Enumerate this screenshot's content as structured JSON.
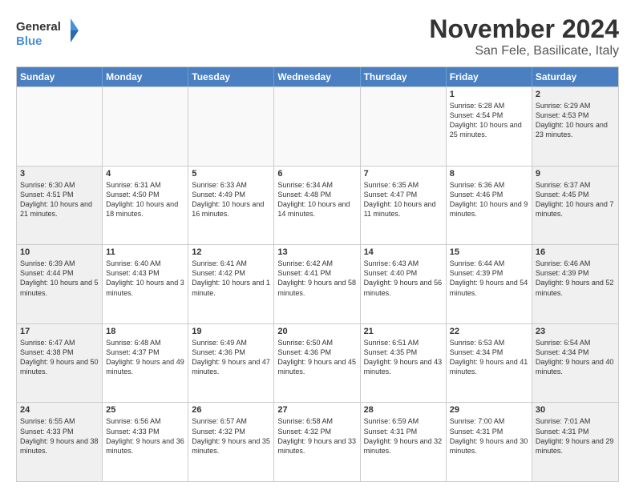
{
  "logo": {
    "line1": "General",
    "line2": "Blue"
  },
  "header": {
    "month": "November 2024",
    "location": "San Fele, Basilicate, Italy"
  },
  "days": [
    "Sunday",
    "Monday",
    "Tuesday",
    "Wednesday",
    "Thursday",
    "Friday",
    "Saturday"
  ],
  "weeks": [
    [
      {
        "day": "",
        "text": ""
      },
      {
        "day": "",
        "text": ""
      },
      {
        "day": "",
        "text": ""
      },
      {
        "day": "",
        "text": ""
      },
      {
        "day": "",
        "text": ""
      },
      {
        "day": "1",
        "text": "Sunrise: 6:28 AM\nSunset: 4:54 PM\nDaylight: 10 hours and 25 minutes."
      },
      {
        "day": "2",
        "text": "Sunrise: 6:29 AM\nSunset: 4:53 PM\nDaylight: 10 hours and 23 minutes."
      }
    ],
    [
      {
        "day": "3",
        "text": "Sunrise: 6:30 AM\nSunset: 4:51 PM\nDaylight: 10 hours and 21 minutes."
      },
      {
        "day": "4",
        "text": "Sunrise: 6:31 AM\nSunset: 4:50 PM\nDaylight: 10 hours and 18 minutes."
      },
      {
        "day": "5",
        "text": "Sunrise: 6:33 AM\nSunset: 4:49 PM\nDaylight: 10 hours and 16 minutes."
      },
      {
        "day": "6",
        "text": "Sunrise: 6:34 AM\nSunset: 4:48 PM\nDaylight: 10 hours and 14 minutes."
      },
      {
        "day": "7",
        "text": "Sunrise: 6:35 AM\nSunset: 4:47 PM\nDaylight: 10 hours and 11 minutes."
      },
      {
        "day": "8",
        "text": "Sunrise: 6:36 AM\nSunset: 4:46 PM\nDaylight: 10 hours and 9 minutes."
      },
      {
        "day": "9",
        "text": "Sunrise: 6:37 AM\nSunset: 4:45 PM\nDaylight: 10 hours and 7 minutes."
      }
    ],
    [
      {
        "day": "10",
        "text": "Sunrise: 6:39 AM\nSunset: 4:44 PM\nDaylight: 10 hours and 5 minutes."
      },
      {
        "day": "11",
        "text": "Sunrise: 6:40 AM\nSunset: 4:43 PM\nDaylight: 10 hours and 3 minutes."
      },
      {
        "day": "12",
        "text": "Sunrise: 6:41 AM\nSunset: 4:42 PM\nDaylight: 10 hours and 1 minute."
      },
      {
        "day": "13",
        "text": "Sunrise: 6:42 AM\nSunset: 4:41 PM\nDaylight: 9 hours and 58 minutes."
      },
      {
        "day": "14",
        "text": "Sunrise: 6:43 AM\nSunset: 4:40 PM\nDaylight: 9 hours and 56 minutes."
      },
      {
        "day": "15",
        "text": "Sunrise: 6:44 AM\nSunset: 4:39 PM\nDaylight: 9 hours and 54 minutes."
      },
      {
        "day": "16",
        "text": "Sunrise: 6:46 AM\nSunset: 4:39 PM\nDaylight: 9 hours and 52 minutes."
      }
    ],
    [
      {
        "day": "17",
        "text": "Sunrise: 6:47 AM\nSunset: 4:38 PM\nDaylight: 9 hours and 50 minutes."
      },
      {
        "day": "18",
        "text": "Sunrise: 6:48 AM\nSunset: 4:37 PM\nDaylight: 9 hours and 49 minutes."
      },
      {
        "day": "19",
        "text": "Sunrise: 6:49 AM\nSunset: 4:36 PM\nDaylight: 9 hours and 47 minutes."
      },
      {
        "day": "20",
        "text": "Sunrise: 6:50 AM\nSunset: 4:36 PM\nDaylight: 9 hours and 45 minutes."
      },
      {
        "day": "21",
        "text": "Sunrise: 6:51 AM\nSunset: 4:35 PM\nDaylight: 9 hours and 43 minutes."
      },
      {
        "day": "22",
        "text": "Sunrise: 6:53 AM\nSunset: 4:34 PM\nDaylight: 9 hours and 41 minutes."
      },
      {
        "day": "23",
        "text": "Sunrise: 6:54 AM\nSunset: 4:34 PM\nDaylight: 9 hours and 40 minutes."
      }
    ],
    [
      {
        "day": "24",
        "text": "Sunrise: 6:55 AM\nSunset: 4:33 PM\nDaylight: 9 hours and 38 minutes."
      },
      {
        "day": "25",
        "text": "Sunrise: 6:56 AM\nSunset: 4:33 PM\nDaylight: 9 hours and 36 minutes."
      },
      {
        "day": "26",
        "text": "Sunrise: 6:57 AM\nSunset: 4:32 PM\nDaylight: 9 hours and 35 minutes."
      },
      {
        "day": "27",
        "text": "Sunrise: 6:58 AM\nSunset: 4:32 PM\nDaylight: 9 hours and 33 minutes."
      },
      {
        "day": "28",
        "text": "Sunrise: 6:59 AM\nSunset: 4:31 PM\nDaylight: 9 hours and 32 minutes."
      },
      {
        "day": "29",
        "text": "Sunrise: 7:00 AM\nSunset: 4:31 PM\nDaylight: 9 hours and 30 minutes."
      },
      {
        "day": "30",
        "text": "Sunrise: 7:01 AM\nSunset: 4:31 PM\nDaylight: 9 hours and 29 minutes."
      }
    ]
  ]
}
